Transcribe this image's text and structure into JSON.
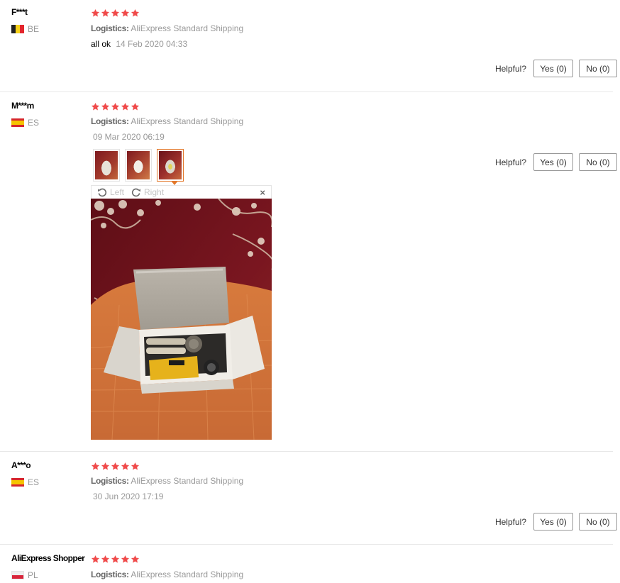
{
  "labels": {
    "logistics_prefix": "Logistics:",
    "helpful_question": "Helpful?",
    "rotate_left": "Left",
    "rotate_right": "Right",
    "close": "×"
  },
  "reviews": [
    {
      "user": "F***t",
      "country": "BE",
      "rating": 5,
      "logistics": "AliExpress Standard Shipping",
      "text": "all ok",
      "date": "14 Feb 2020 04:33",
      "yes": "Yes (0)",
      "no": "No (0)"
    },
    {
      "user": "M***m",
      "country": "ES",
      "rating": 5,
      "logistics": "AliExpress Standard Shipping",
      "text": "",
      "date": "09 Mar 2020 06:19",
      "yes": "Yes (0)",
      "no": "No (0)",
      "photo_count": 3,
      "selected_photo": 3
    },
    {
      "user": "A***o",
      "country": "ES",
      "rating": 5,
      "logistics": "AliExpress Standard Shipping",
      "text": "",
      "date": "30 Jun 2020 17:19",
      "yes": "Yes (0)",
      "no": "No (0)"
    },
    {
      "user": "AliExpress Shopper",
      "country": "PL",
      "rating": 5,
      "logistics": "AliExpress Standard Shipping"
    }
  ],
  "colors": {
    "star": "#f04b4b",
    "active_thumb_border": "#e3782a",
    "muted_text": "#999999"
  },
  "icons": {
    "star": "star-icon",
    "rotate_left": "rotate-left-icon",
    "rotate_right": "rotate-right-icon",
    "close": "close-icon"
  }
}
